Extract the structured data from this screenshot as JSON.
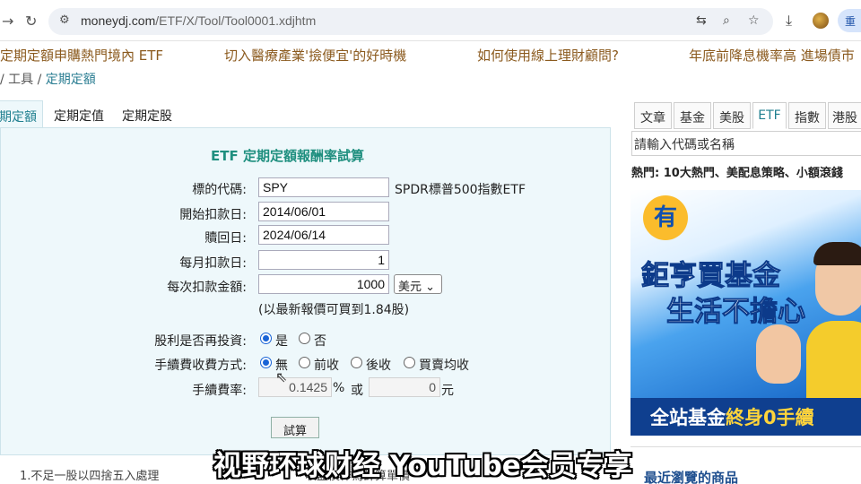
{
  "browser": {
    "url_host": "moneydj.com",
    "url_path": "/ETF/X/Tool/Tool0001.xdjhtm",
    "profile_label": "重"
  },
  "ticker": [
    "定期定額申購熱門境內 ETF",
    "切入醫療產業'撿便宜'的好時機",
    "如何使用線上理財顧問?",
    "年底前降息機率高 進場債市"
  ],
  "breadcrumb": {
    "sep1": "/",
    "item1": "工具",
    "sep2": "/",
    "item2": "定期定額"
  },
  "tabs": [
    {
      "label": "期定額"
    },
    {
      "label": "定期定值"
    },
    {
      "label": "定期定股"
    }
  ],
  "calculator": {
    "title": "ETF 定期定額報酬率試算",
    "symbol_label": "標的代碼:",
    "symbol_value": "SPY",
    "symbol_name": "SPDR標普500指數ETF",
    "start_label": "開始扣款日:",
    "start_value": "2014/06/01",
    "redeem_label": "贖回日:",
    "redeem_value": "2024/06/14",
    "day_label": "每月扣款日:",
    "day_value": "1",
    "amount_label": "每次扣款金額:",
    "amount_value": "1000",
    "currency": "美元",
    "shares_note": "(以最新報價可買到1.84股)",
    "dividend_label": "股利是否再投資:",
    "dividend_yes": "是",
    "dividend_no": "否",
    "fee_method_label": "手續費收費方式:",
    "fee_none": "無",
    "fee_front": "前收",
    "fee_back": "後收",
    "fee_both": "買賣均收",
    "fee_rate_label": "手續費率:",
    "fee_rate_value": "0.1425",
    "fee_rate_unit": "%",
    "or_text": "或",
    "fee_fixed_value": "0",
    "fee_fixed_unit": "元",
    "submit_label": "試算"
  },
  "footnote": "1.不足一股以四捨五入處理",
  "footnote2": "收盤價作為計算單價",
  "sidebar": {
    "tabs": [
      "文章",
      "基金",
      "美股",
      "ETF",
      "指數",
      "港股"
    ],
    "search_placeholder": "請輸入代碼或名稱",
    "hot": "熱門: 10大熱門、美配息策略、小額滾錢",
    "ad": {
      "badge": "有",
      "line1": "鉅亨買基金",
      "line2": "生活不擔心",
      "strip_a": "全站基金",
      "strip_b": "終身0手續"
    },
    "recent": "最近瀏覽的商品"
  },
  "subtitle": "视野环球财经 YouTube会员专享"
}
